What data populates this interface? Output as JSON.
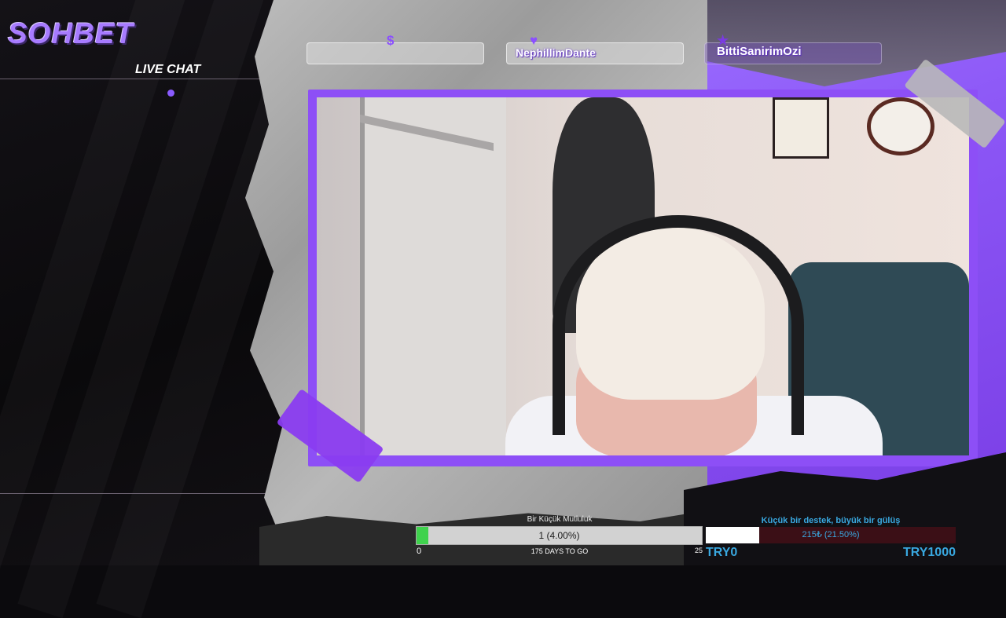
{
  "sidebar": {
    "brand": "SOHBET",
    "subtitle": "LIVE CHAT"
  },
  "events": [
    {
      "icon": "dollar-icon",
      "glyph": "$",
      "name": ""
    },
    {
      "icon": "heart-icon",
      "glyph": "♥",
      "name": "NephillimDante"
    },
    {
      "icon": "star-icon",
      "glyph": "★",
      "name": "BittiSanirimOzi"
    }
  ],
  "goal": {
    "title": "Bir Küçük Mutluluk",
    "progress_text": "1 (4.00%)",
    "fraction": 0.04,
    "min": "0",
    "max": "25",
    "days_left": "175 DAYS TO GO"
  },
  "donation": {
    "title": "Küçük bir destek, büyük bir gülüş",
    "progress_text": "215₺ (21.50%)",
    "fraction": 0.215,
    "min": "TRY0",
    "max": "TRY1000"
  },
  "colors": {
    "accent": "#8d4ff6",
    "goal_fill": "#3fd24d",
    "donation_text": "#39a8e0"
  }
}
